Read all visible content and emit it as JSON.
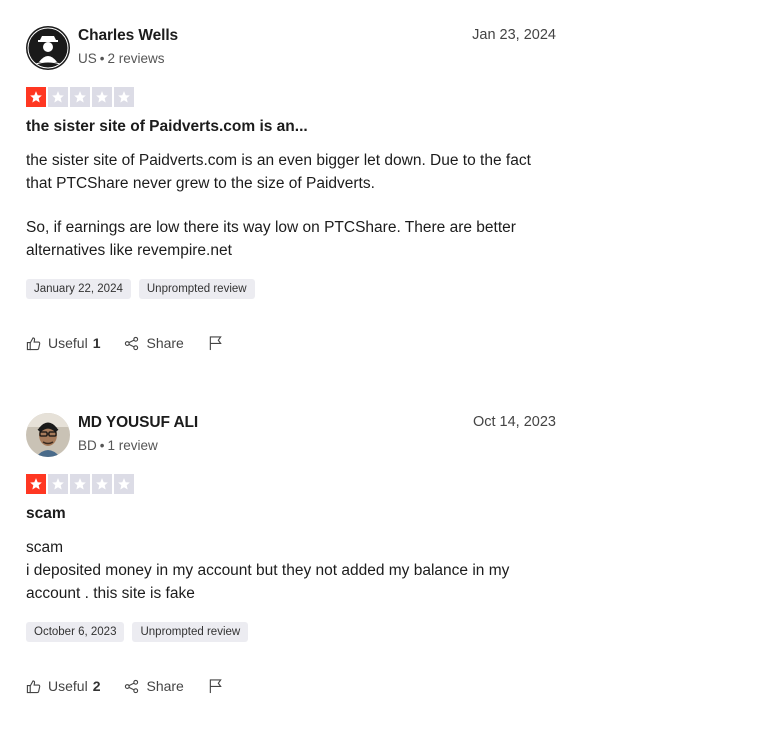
{
  "reviews": [
    {
      "name": "Charles Wells",
      "country": "US",
      "reviews_count": "2 reviews",
      "date": "Jan 23, 2024",
      "rating": 1,
      "title": "the sister site of Paidverts.com is an...",
      "body": [
        "the sister site of Paidverts.com is an even bigger let down. Due to the fact that PTCShare never grew to the size of Paidverts.",
        "So, if earnings are low there its way low on PTCShare. There are better alternatives like revempire.net"
      ],
      "experience_date": "January 22, 2024",
      "tag": "Unprompted review",
      "useful_label": "Useful",
      "useful_count": "1",
      "share_label": "Share"
    },
    {
      "name": "MD YOUSUF ALI",
      "country": "BD",
      "reviews_count": "1 review",
      "date": "Oct 14, 2023",
      "rating": 1,
      "title": "scam",
      "body": [
        "scam",
        "i deposited money in my account but they not added my balance in my account . this site is fake"
      ],
      "experience_date": "October 6, 2023",
      "tag": "Unprompted review",
      "useful_label": "Useful",
      "useful_count": "2",
      "share_label": "Share"
    }
  ],
  "colors": {
    "star_on": "#ff3722",
    "star_off": "#dcdce6",
    "tag_bg": "#ececf1"
  }
}
